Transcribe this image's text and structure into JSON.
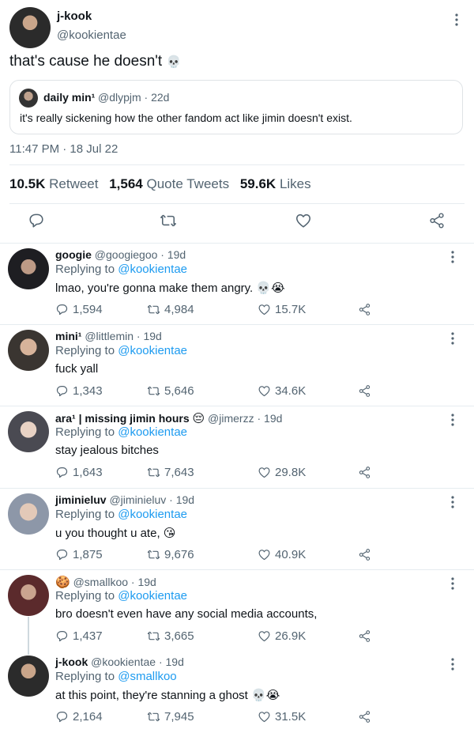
{
  "main_tweet": {
    "name": "j-kook",
    "handle": "@kookientae",
    "text": "that's cause he doesn't",
    "text_emoji": "💀",
    "quote": {
      "name": "daily min¹",
      "handle": "@dlypjm · 22d",
      "text": "it's really sickening how the other fandom act like jimin doesn't exist."
    },
    "timestamp": "11:47 PM · 18 Jul 22",
    "stats": {
      "retweets": "10.5K",
      "retweets_label": "Retweet",
      "quotes": "1,564",
      "quotes_label": "Quote Tweets",
      "likes": "59.6K",
      "likes_label": "Likes"
    },
    "icons": [
      "reply-icon",
      "retweet-icon",
      "like-icon",
      "share-icon"
    ]
  },
  "accent_color": "#1d9bf0",
  "replies": [
    {
      "name": "googie",
      "handle": "@googiegoo",
      "time": "19d",
      "replying_label": "Replying to",
      "replying_to": "@kookientae",
      "text": "lmao, you're gonna make them angry.",
      "emoji": "💀😭",
      "replies": "1,594",
      "retweets": "4,984",
      "likes": "15.7K"
    },
    {
      "name": "mini¹",
      "handle": "@littlemin",
      "time": "19d",
      "replying_label": "Replying to",
      "replying_to": "@kookientae",
      "text": "fuck yall",
      "emoji": "",
      "replies": "1,343",
      "retweets": "5,646",
      "likes": "34.6K"
    },
    {
      "name": "ara¹ | missing jimin hours",
      "name_emoji": "😔",
      "handle": "@jimerzz",
      "time": "19d",
      "replying_label": "Replying to",
      "replying_to": "@kookientae",
      "text": "stay jealous bitches",
      "emoji": "",
      "replies": "1,643",
      "retweets": "7,643",
      "likes": "29.8K"
    },
    {
      "name": "jiminieluv",
      "handle": "@jiminieluv",
      "time": "19d",
      "replying_label": "Replying to",
      "replying_to": "@kookientae",
      "text": "u you thought u ate,",
      "emoji": "😘",
      "replies": "1,875",
      "retweets": "9,676",
      "likes": "40.9K"
    },
    {
      "name_emoji": "🍪",
      "name": "",
      "handle": "@smallkoo",
      "time": "19d",
      "replying_label": "Replying to",
      "replying_to": "@kookientae",
      "text": "bro doesn't even have any social media accounts,",
      "emoji": "",
      "replies": "1,437",
      "retweets": "3,665",
      "likes": "26.9K"
    },
    {
      "name": "j-kook",
      "handle": "@kookientae",
      "time": "19d",
      "replying_label": "Replying to",
      "replying_to": "@smallkoo",
      "text": "at this point, they're stanning a ghost",
      "emoji": "💀😭",
      "replies": "2,164",
      "retweets": "7,945",
      "likes": "31.5K"
    }
  ]
}
